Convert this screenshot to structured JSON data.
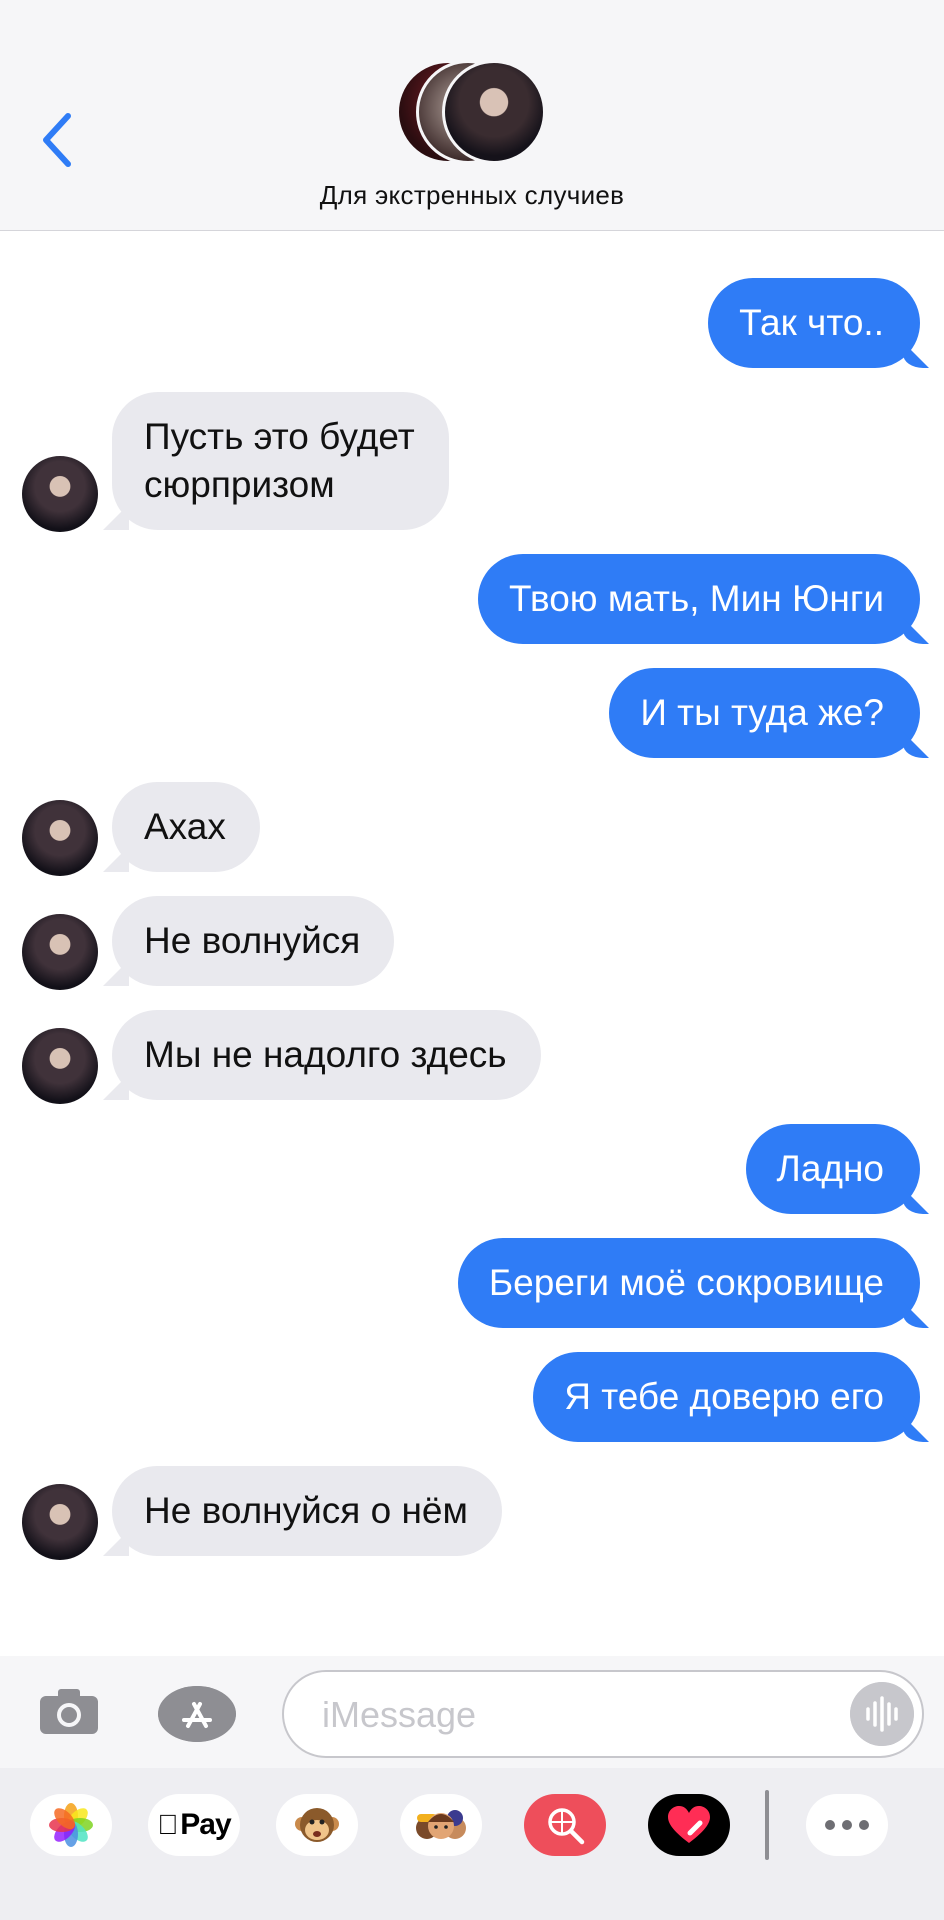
{
  "header": {
    "back_icon": "chevron-left-icon",
    "title": "Для экстренных случиев",
    "accent": "#2f7cf6"
  },
  "messages": [
    {
      "side": "out",
      "text": "Так что.."
    },
    {
      "side": "in",
      "text": "Пусть это будет\nсюрпризом"
    },
    {
      "side": "out",
      "text": "Твою мать, Мин Юнги"
    },
    {
      "side": "out",
      "text": "И ты туда же?"
    },
    {
      "side": "in",
      "text": "Ахах"
    },
    {
      "side": "in",
      "text": "Не волнуйся"
    },
    {
      "side": "in",
      "text": "Мы не надолго здесь"
    },
    {
      "side": "out",
      "text": "Ладно"
    },
    {
      "side": "out",
      "text": "Береги моё сокровище"
    },
    {
      "side": "out",
      "text": "Я тебе доверю его"
    },
    {
      "side": "in",
      "text": "Не волнуйся о нём"
    }
  ],
  "compose": {
    "placeholder": "iMessage",
    "camera_icon": "camera-icon",
    "apps_icon": "app-store-icon",
    "audio_icon": "waveform-icon"
  },
  "app_drawer": {
    "items": [
      "photos-icon",
      "apple-pay-icon",
      "animoji-icon",
      "memoji-icon",
      "web-search-icon",
      "digital-touch-icon",
      "more-icon"
    ],
    "pay_label": "Pay"
  },
  "colors": {
    "outgoing_bubble": "#2f7cf6",
    "incoming_bubble": "#e9e9ee"
  }
}
